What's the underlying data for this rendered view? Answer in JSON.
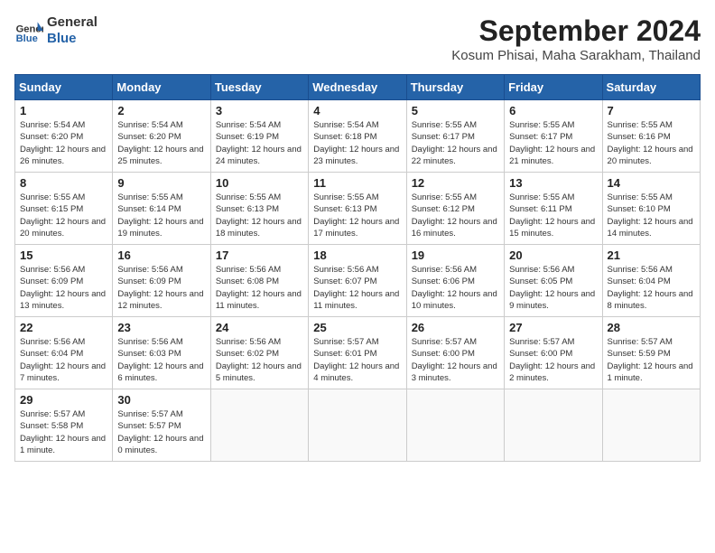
{
  "header": {
    "logo_line1": "General",
    "logo_line2": "Blue",
    "month": "September 2024",
    "location": "Kosum Phisai, Maha Sarakham, Thailand"
  },
  "days_of_week": [
    "Sunday",
    "Monday",
    "Tuesday",
    "Wednesday",
    "Thursday",
    "Friday",
    "Saturday"
  ],
  "weeks": [
    [
      {
        "day": "1",
        "sunrise": "5:54 AM",
        "sunset": "6:20 PM",
        "daylight": "12 hours and 26 minutes."
      },
      {
        "day": "2",
        "sunrise": "5:54 AM",
        "sunset": "6:20 PM",
        "daylight": "12 hours and 25 minutes."
      },
      {
        "day": "3",
        "sunrise": "5:54 AM",
        "sunset": "6:19 PM",
        "daylight": "12 hours and 24 minutes."
      },
      {
        "day": "4",
        "sunrise": "5:54 AM",
        "sunset": "6:18 PM",
        "daylight": "12 hours and 23 minutes."
      },
      {
        "day": "5",
        "sunrise": "5:55 AM",
        "sunset": "6:17 PM",
        "daylight": "12 hours and 22 minutes."
      },
      {
        "day": "6",
        "sunrise": "5:55 AM",
        "sunset": "6:17 PM",
        "daylight": "12 hours and 21 minutes."
      },
      {
        "day": "7",
        "sunrise": "5:55 AM",
        "sunset": "6:16 PM",
        "daylight": "12 hours and 20 minutes."
      }
    ],
    [
      {
        "day": "8",
        "sunrise": "5:55 AM",
        "sunset": "6:15 PM",
        "daylight": "12 hours and 20 minutes."
      },
      {
        "day": "9",
        "sunrise": "5:55 AM",
        "sunset": "6:14 PM",
        "daylight": "12 hours and 19 minutes."
      },
      {
        "day": "10",
        "sunrise": "5:55 AM",
        "sunset": "6:13 PM",
        "daylight": "12 hours and 18 minutes."
      },
      {
        "day": "11",
        "sunrise": "5:55 AM",
        "sunset": "6:13 PM",
        "daylight": "12 hours and 17 minutes."
      },
      {
        "day": "12",
        "sunrise": "5:55 AM",
        "sunset": "6:12 PM",
        "daylight": "12 hours and 16 minutes."
      },
      {
        "day": "13",
        "sunrise": "5:55 AM",
        "sunset": "6:11 PM",
        "daylight": "12 hours and 15 minutes."
      },
      {
        "day": "14",
        "sunrise": "5:55 AM",
        "sunset": "6:10 PM",
        "daylight": "12 hours and 14 minutes."
      }
    ],
    [
      {
        "day": "15",
        "sunrise": "5:56 AM",
        "sunset": "6:09 PM",
        "daylight": "12 hours and 13 minutes."
      },
      {
        "day": "16",
        "sunrise": "5:56 AM",
        "sunset": "6:09 PM",
        "daylight": "12 hours and 12 minutes."
      },
      {
        "day": "17",
        "sunrise": "5:56 AM",
        "sunset": "6:08 PM",
        "daylight": "12 hours and 11 minutes."
      },
      {
        "day": "18",
        "sunrise": "5:56 AM",
        "sunset": "6:07 PM",
        "daylight": "12 hours and 11 minutes."
      },
      {
        "day": "19",
        "sunrise": "5:56 AM",
        "sunset": "6:06 PM",
        "daylight": "12 hours and 10 minutes."
      },
      {
        "day": "20",
        "sunrise": "5:56 AM",
        "sunset": "6:05 PM",
        "daylight": "12 hours and 9 minutes."
      },
      {
        "day": "21",
        "sunrise": "5:56 AM",
        "sunset": "6:04 PM",
        "daylight": "12 hours and 8 minutes."
      }
    ],
    [
      {
        "day": "22",
        "sunrise": "5:56 AM",
        "sunset": "6:04 PM",
        "daylight": "12 hours and 7 minutes."
      },
      {
        "day": "23",
        "sunrise": "5:56 AM",
        "sunset": "6:03 PM",
        "daylight": "12 hours and 6 minutes."
      },
      {
        "day": "24",
        "sunrise": "5:56 AM",
        "sunset": "6:02 PM",
        "daylight": "12 hours and 5 minutes."
      },
      {
        "day": "25",
        "sunrise": "5:57 AM",
        "sunset": "6:01 PM",
        "daylight": "12 hours and 4 minutes."
      },
      {
        "day": "26",
        "sunrise": "5:57 AM",
        "sunset": "6:00 PM",
        "daylight": "12 hours and 3 minutes."
      },
      {
        "day": "27",
        "sunrise": "5:57 AM",
        "sunset": "6:00 PM",
        "daylight": "12 hours and 2 minutes."
      },
      {
        "day": "28",
        "sunrise": "5:57 AM",
        "sunset": "5:59 PM",
        "daylight": "12 hours and 1 minute."
      }
    ],
    [
      {
        "day": "29",
        "sunrise": "5:57 AM",
        "sunset": "5:58 PM",
        "daylight": "12 hours and 1 minute."
      },
      {
        "day": "30",
        "sunrise": "5:57 AM",
        "sunset": "5:57 PM",
        "daylight": "12 hours and 0 minutes."
      },
      null,
      null,
      null,
      null,
      null
    ]
  ]
}
